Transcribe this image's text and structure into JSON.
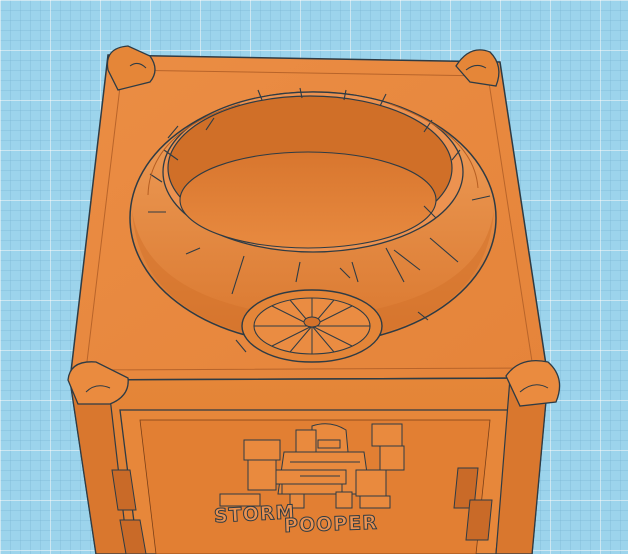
{
  "viewport": {
    "grid_color": "#9cd4ec",
    "model_color": "#e8883e",
    "model_shadow": "#c96a28",
    "model_highlight": "#f29a50",
    "edge_color": "#2e3b44"
  },
  "model": {
    "emboss_line1": "STORM",
    "emboss_line2": "POOPER"
  }
}
